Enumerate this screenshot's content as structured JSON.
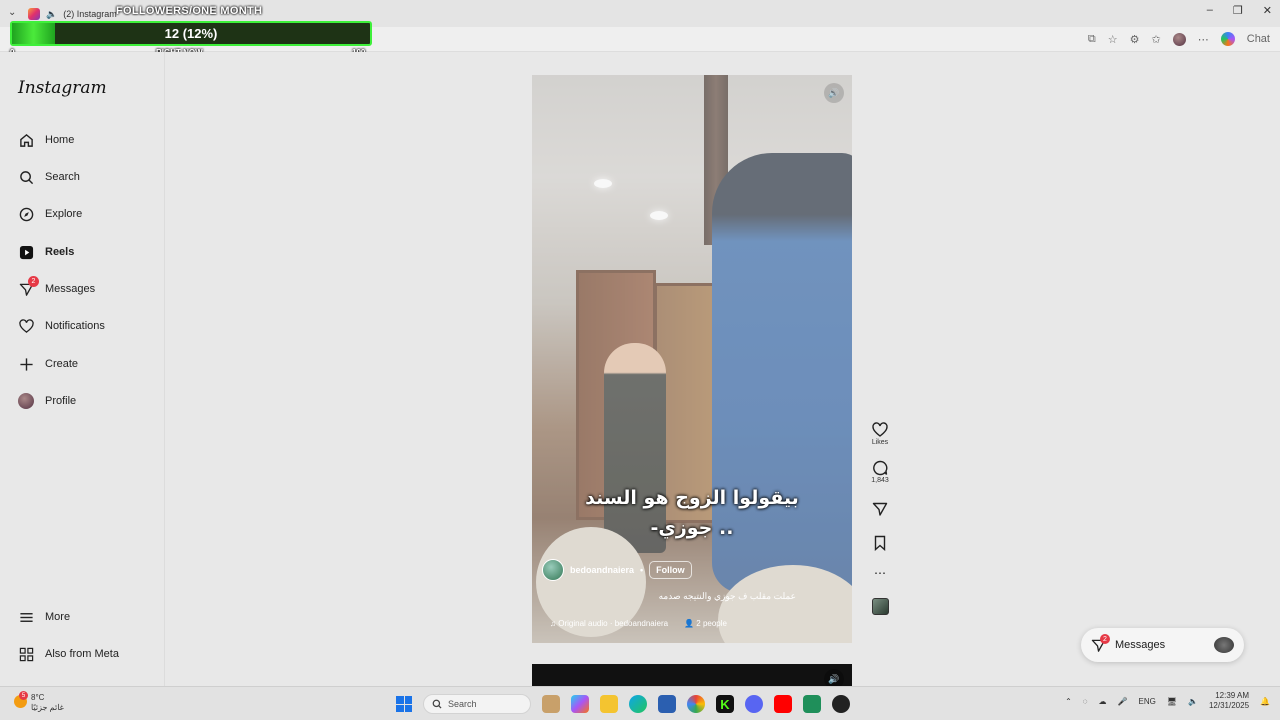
{
  "browser": {
    "tab_title": "(2) Instagram",
    "chat_label": "Chat"
  },
  "overlay": {
    "title": "FOLLOWERS/ONE MONTH",
    "progress_text": "12 (12%)",
    "progress_fraction": 0.12,
    "scale_min": "0",
    "scale_mid": "RIGHT NOW",
    "scale_max": "100",
    "accent_color": "#3ef03a"
  },
  "sidebar": {
    "logo": "Instagram",
    "items": [
      {
        "label": "Home",
        "icon": "home-icon"
      },
      {
        "label": "Search",
        "icon": "search-icon"
      },
      {
        "label": "Explore",
        "icon": "compass-icon"
      },
      {
        "label": "Reels",
        "icon": "reels-icon"
      },
      {
        "label": "Messages",
        "icon": "messenger-icon",
        "badge": "2"
      },
      {
        "label": "Notifications",
        "icon": "heart-icon"
      },
      {
        "label": "Create",
        "icon": "plus-icon"
      },
      {
        "label": "Profile",
        "icon": "avatar"
      }
    ],
    "more": "More",
    "also_from_meta": "Also from Meta"
  },
  "reel": {
    "caption_line1": "بيقولوا الزوج هو السند",
    "caption_line2": "-جوزي ..",
    "username": "bedoandnaiera",
    "follow_label": "Follow",
    "description": "عملت مقلب ف جوزي والنتيجه صدمه",
    "audio": "Original audio · bedoandnaiera",
    "people": "2 people"
  },
  "actions": {
    "likes_label": "Likes",
    "comments_count": "1,843"
  },
  "messages_pill": {
    "label": "Messages",
    "badge": "2"
  },
  "taskbar": {
    "weather_temp": "8°C",
    "weather_text": "غائم جزئيًا",
    "weather_badge": "5",
    "search_placeholder": "Search",
    "lang": "ENG",
    "time": "12:39 AM",
    "date": "12/31/2025"
  }
}
